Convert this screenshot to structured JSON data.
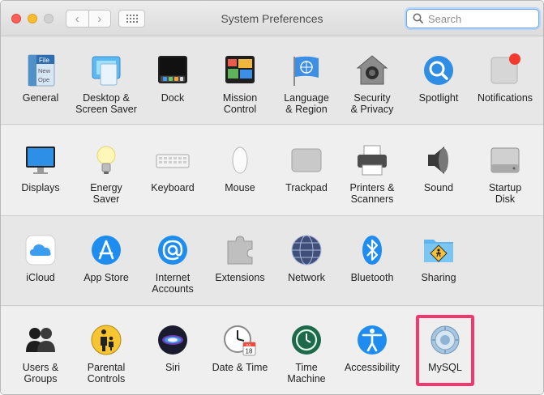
{
  "window": {
    "title": "System Preferences"
  },
  "search": {
    "placeholder": "Search"
  },
  "nav": {
    "back": "‹",
    "forward": "›"
  },
  "rows": [
    [
      {
        "label": "General"
      },
      {
        "label": "Desktop &\nScreen Saver"
      },
      {
        "label": "Dock"
      },
      {
        "label": "Mission\nControl"
      },
      {
        "label": "Language\n& Region"
      },
      {
        "label": "Security\n& Privacy"
      },
      {
        "label": "Spotlight"
      },
      {
        "label": "Notifications"
      }
    ],
    [
      {
        "label": "Displays"
      },
      {
        "label": "Energy\nSaver"
      },
      {
        "label": "Keyboard"
      },
      {
        "label": "Mouse"
      },
      {
        "label": "Trackpad"
      },
      {
        "label": "Printers &\nScanners"
      },
      {
        "label": "Sound"
      },
      {
        "label": "Startup\nDisk"
      }
    ],
    [
      {
        "label": "iCloud"
      },
      {
        "label": "App Store"
      },
      {
        "label": "Internet\nAccounts"
      },
      {
        "label": "Extensions"
      },
      {
        "label": "Network"
      },
      {
        "label": "Bluetooth"
      },
      {
        "label": "Sharing"
      }
    ],
    [
      {
        "label": "Users &\nGroups"
      },
      {
        "label": "Parental\nControls"
      },
      {
        "label": "Siri"
      },
      {
        "label": "Date & Time"
      },
      {
        "label": "Time\nMachine"
      },
      {
        "label": "Accessibility"
      },
      {
        "label": "MySQL"
      }
    ]
  ],
  "icons": {
    "general_file_label": "File",
    "general_new_label": "New",
    "general_open_label": "Ope",
    "calendar_month": "JUL",
    "calendar_day": "18"
  },
  "colors": {
    "highlight": "#f2386f",
    "accent": "#2f7fe8"
  }
}
